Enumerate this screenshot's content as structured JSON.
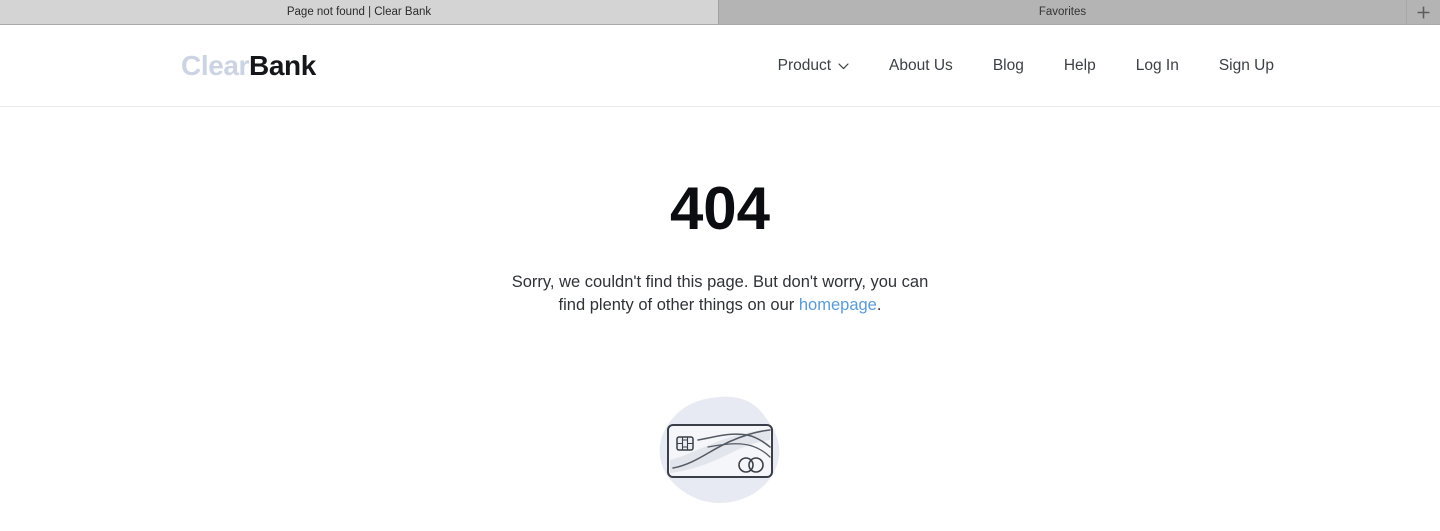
{
  "browser": {
    "tabs": [
      {
        "title": "Page not found | Clear Bank",
        "active": true
      },
      {
        "title": "Favorites",
        "active": false
      }
    ],
    "new_tab_label": "+"
  },
  "header": {
    "logo": {
      "part1": "Clear",
      "part2": "Bank",
      "part1_color": "#ccd3e2",
      "part2_color": "#14161a"
    },
    "nav": [
      {
        "label": "Product",
        "has_dropdown": true
      },
      {
        "label": "About Us",
        "has_dropdown": false
      },
      {
        "label": "Blog",
        "has_dropdown": false
      },
      {
        "label": "Help",
        "has_dropdown": false
      },
      {
        "label": "Log In",
        "has_dropdown": false
      },
      {
        "label": "Sign Up",
        "has_dropdown": false
      }
    ]
  },
  "main": {
    "error_code": "404",
    "message_before_link": "Sorry, we couldn't find this page. But don't worry, you can find plenty of other things on our ",
    "link_text": "homepage",
    "message_after_link": ".",
    "link_color": "#5b9bd5",
    "illustration": {
      "name": "bank-card-illustration",
      "blob_color": "#e7eaf2",
      "card_outline_color": "#3a3f47",
      "card_face_color": "#f4f5f8"
    }
  }
}
